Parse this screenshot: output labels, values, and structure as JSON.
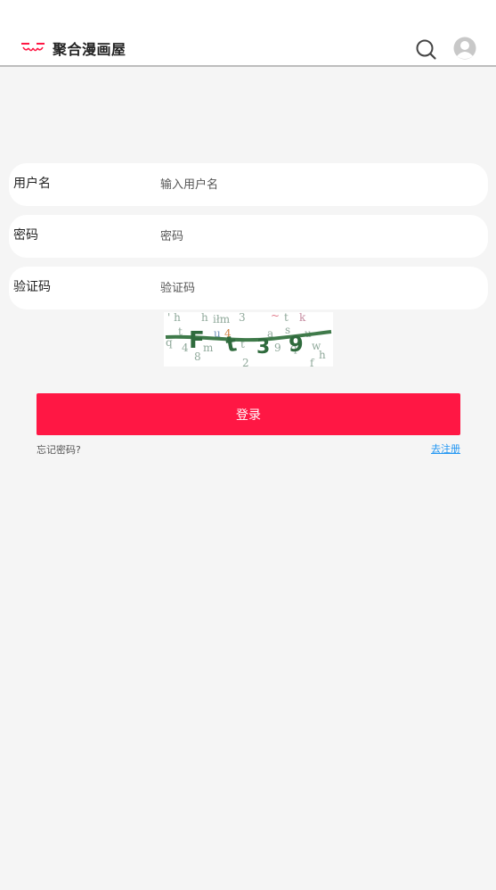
{
  "header": {
    "site_title": "聚合漫画屋",
    "logo_icon": "cat-face-logo-icon",
    "search_icon": "search-icon",
    "avatar_icon": "user-avatar-icon",
    "brand_color": "#ff1744"
  },
  "form": {
    "username": {
      "label": "用户名",
      "placeholder": "输入用户名",
      "value": ""
    },
    "password": {
      "label": "密码",
      "placeholder": "密码",
      "value": ""
    },
    "captcha": {
      "label": "验证码",
      "placeholder": "验证码",
      "value": ""
    },
    "captcha_image_text": "Ft39"
  },
  "actions": {
    "login_label": "登录",
    "forgot_label": "忘记密码?",
    "register_label": "去注册",
    "button_color": "#ff1744",
    "link_color": "#2196f3"
  }
}
